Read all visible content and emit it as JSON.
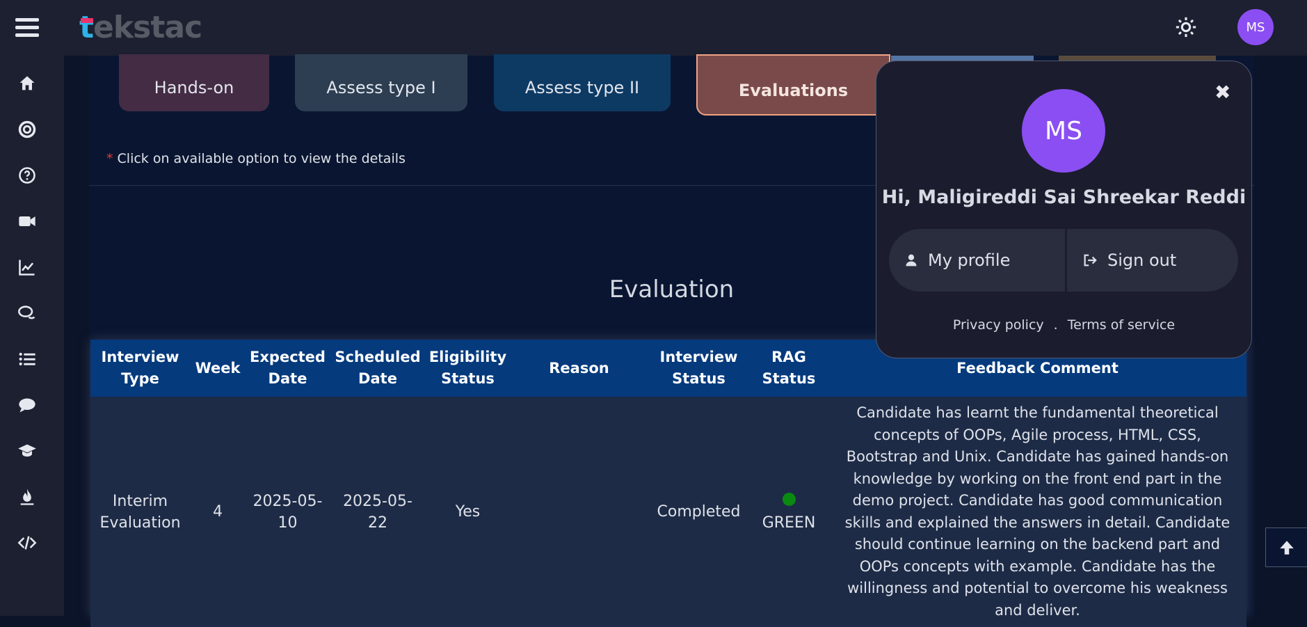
{
  "app": {
    "logo": "tekstac",
    "logo_first": "t",
    "logo_rest": "ekstac"
  },
  "user": {
    "initials": "MS",
    "greeting": "Hi, Maligireddi Sai Shreekar Reddi"
  },
  "colors": {
    "accent": "#8b4ef2",
    "header_bg": "#053a7d",
    "rag_green": "#0a8a12"
  },
  "icons": {
    "sidebar": [
      "home-icon",
      "support-icon",
      "help-icon",
      "video-icon",
      "chart-line-icon",
      "comments-icon",
      "list-icon",
      "chat-icon",
      "graduation-cap-icon",
      "fire-icon",
      "code-icon"
    ]
  },
  "tiles": {
    "hands_on": "Hands-on",
    "assess1": "Assess type I",
    "assess2": "Assess type II",
    "evaluations": "Evaluations"
  },
  "hint": {
    "star": "*",
    "text": " Click on available option to view the details"
  },
  "section_title": "Evaluation",
  "table": {
    "headers": {
      "interview_type": [
        "Interview",
        "Type"
      ],
      "week": "Week",
      "expected_date": [
        "Expected",
        "Date"
      ],
      "scheduled_date": [
        "Scheduled",
        "Date"
      ],
      "eligibility_status": [
        "Eligibility",
        "Status"
      ],
      "reason": "Reason",
      "interview_status": [
        "Interview",
        "Status"
      ],
      "rag_status": [
        "RAG",
        "Status"
      ],
      "feedback_comment": "Feedback Comment"
    },
    "rows": [
      {
        "interview_type": [
          "Interim",
          "Evaluation"
        ],
        "week": "4",
        "expected_date": [
          "2025-05-",
          "10"
        ],
        "scheduled_date": [
          "2025-05-",
          "22"
        ],
        "eligibility_status": "Yes",
        "reason": "",
        "interview_status": "Completed",
        "rag_status": "GREEN",
        "feedback_comment": "Candidate has learnt the fundamental theoretical concepts of OOPs, Agile process, HTML, CSS, Bootstrap and Unix. Candidate has gained hands-on knowledge by working on the front end part in the demo project. Candidate has good communication skills and explained the answers in detail. Candidate should continue learning on the backend part and OOPs concepts with example. Candidate has the willingness and potential to overcome his weakness and deliver."
      }
    ]
  },
  "popup": {
    "close": "✖",
    "my_profile": "My profile",
    "sign_out": "Sign out",
    "privacy": "Privacy policy",
    "separator": ".",
    "terms": "Terms of service"
  }
}
